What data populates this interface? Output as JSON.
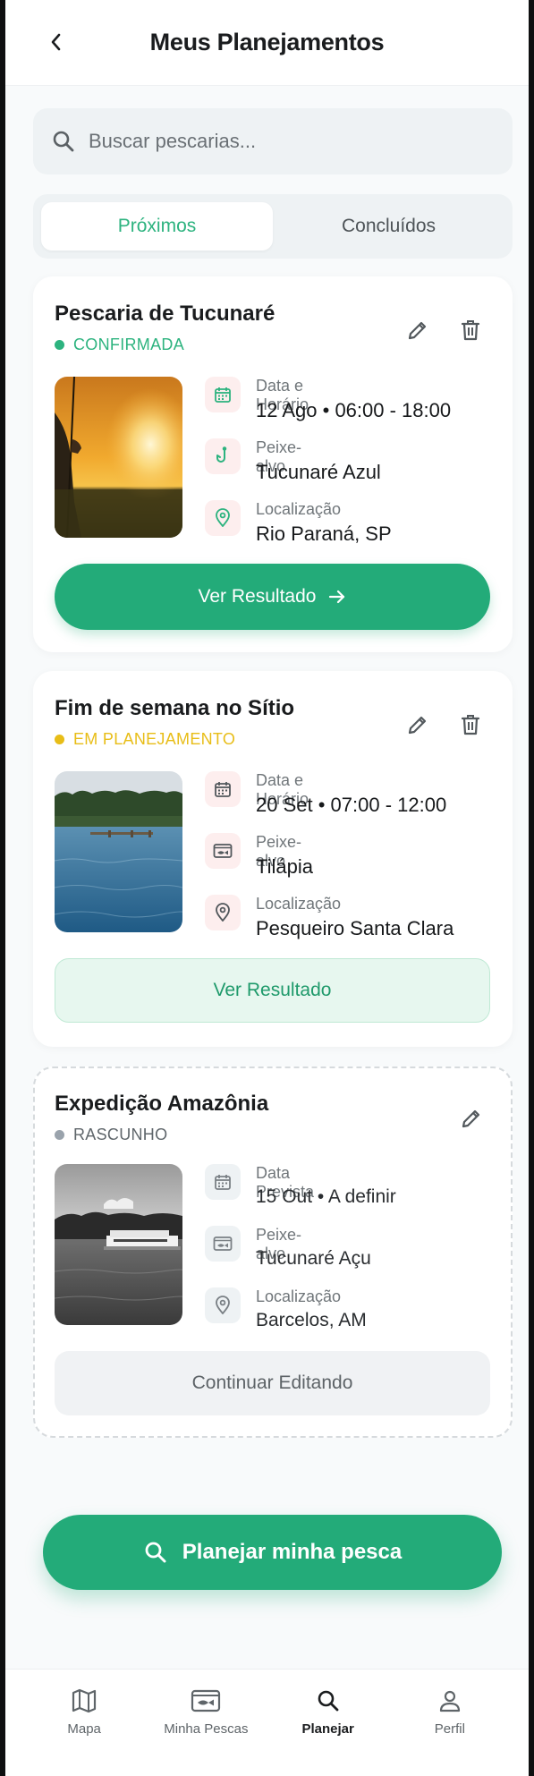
{
  "header": {
    "title": "Meus Planejamentos"
  },
  "search": {
    "placeholder": "Buscar pescarias..."
  },
  "tabs": [
    {
      "label": "Próximos",
      "active": true
    },
    {
      "label": "Concluídos",
      "active": false
    }
  ],
  "cards": [
    {
      "title": "Pescaria de Tucunaré",
      "status": "CONFIRMADA",
      "status_color": "#2db37f",
      "date_label": "Data e Horário",
      "date_value": "12 Ago • 06:00 - 18:00",
      "fish_label": "Peixe-alvo",
      "fish_value": "Tucunaré Azul",
      "location_label": "Localização",
      "location_value": "Rio Paraná, SP",
      "button_label": "Ver Resultado"
    },
    {
      "title": "Fim de semana no Sítio",
      "status": "EM PLANEJAMENTO",
      "status_color": "#e8bd17",
      "date_label": "Data e Horário",
      "date_value": "20 Set • 07:00 - 12:00",
      "fish_label": "Peixe-alvo",
      "fish_value": "Tilápia",
      "location_label": "Localização",
      "location_value": "Pesqueiro Santa Clara",
      "button_label": "Ver Resultado"
    },
    {
      "title": "Expedição Amazônia",
      "status": "RASCUNHO",
      "status_color": "#9aa3ac",
      "date_label": "Data Prevista",
      "date_value": "15 Out • A definir",
      "fish_label": "Peixe-alvo",
      "fish_value": "Tucunaré Açu",
      "location_label": "Localização",
      "location_value": "Barcelos, AM",
      "button_label": "Continuar Editando"
    }
  ],
  "plan_button": {
    "label": "Planejar minha pesca"
  },
  "bottom_nav": [
    {
      "label": "Mapa",
      "icon": "map-icon",
      "active": false
    },
    {
      "label": "Minha Pescas",
      "icon": "fish-card-icon",
      "active": false
    },
    {
      "label": "Planejar",
      "icon": "search-icon",
      "active": true
    },
    {
      "label": "Perfil",
      "icon": "user-icon",
      "active": false
    }
  ],
  "colors": {
    "accent": "#23ab79",
    "accent_text": "#2db37f",
    "confirmed": "#2db37f",
    "planning": "#e8bd17",
    "draft": "#9aa3ac"
  }
}
